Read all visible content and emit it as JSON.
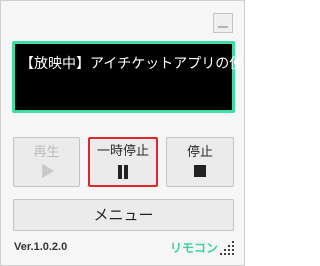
{
  "screen": {
    "now_playing": "【放映中】アイチケットアプリの使い方"
  },
  "controls": {
    "play": {
      "label": "再生",
      "enabled": false,
      "icon": "play-icon"
    },
    "pause": {
      "label": "一時停止",
      "highlighted": true,
      "icon": "pause-icon"
    },
    "stop": {
      "label": "停止",
      "icon": "stop-icon"
    }
  },
  "menu_label": "メニュー",
  "footer": {
    "version": "Ver.1.0.2.0",
    "brand": "リモコン"
  },
  "colors": {
    "screen_border": "#3fdca4",
    "brand": "#3fcf9a",
    "pause_highlight": "#e0262a"
  }
}
